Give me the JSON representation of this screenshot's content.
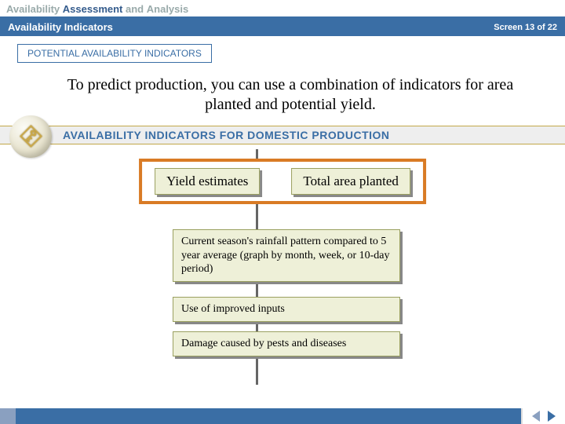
{
  "header": {
    "w1": "Availability",
    "w2": "Assessment",
    "w3": "and",
    "w4": "Analysis",
    "subtitle": "Availability Indicators",
    "screen": "Screen 13 of 22"
  },
  "tab": "POTENTIAL AVAILABILITY INDICATORS",
  "intro": "To predict production, you can use a combination of indicators for area planted and potential yield.",
  "band": "AVAILABILITY INDICATORS FOR DOMESTIC PRODUCTION",
  "top": {
    "left": "Yield estimates",
    "right": "Total area planted"
  },
  "boxes": {
    "b1": "Current season's rainfall pattern compared to 5 year average (graph by month, week, or 10-day period)",
    "b2": "Use of improved inputs",
    "b3": "Damage caused by pests and diseases"
  },
  "icons": {
    "key": "key-icon",
    "prev": "prev-arrow",
    "next": "next-arrow"
  }
}
